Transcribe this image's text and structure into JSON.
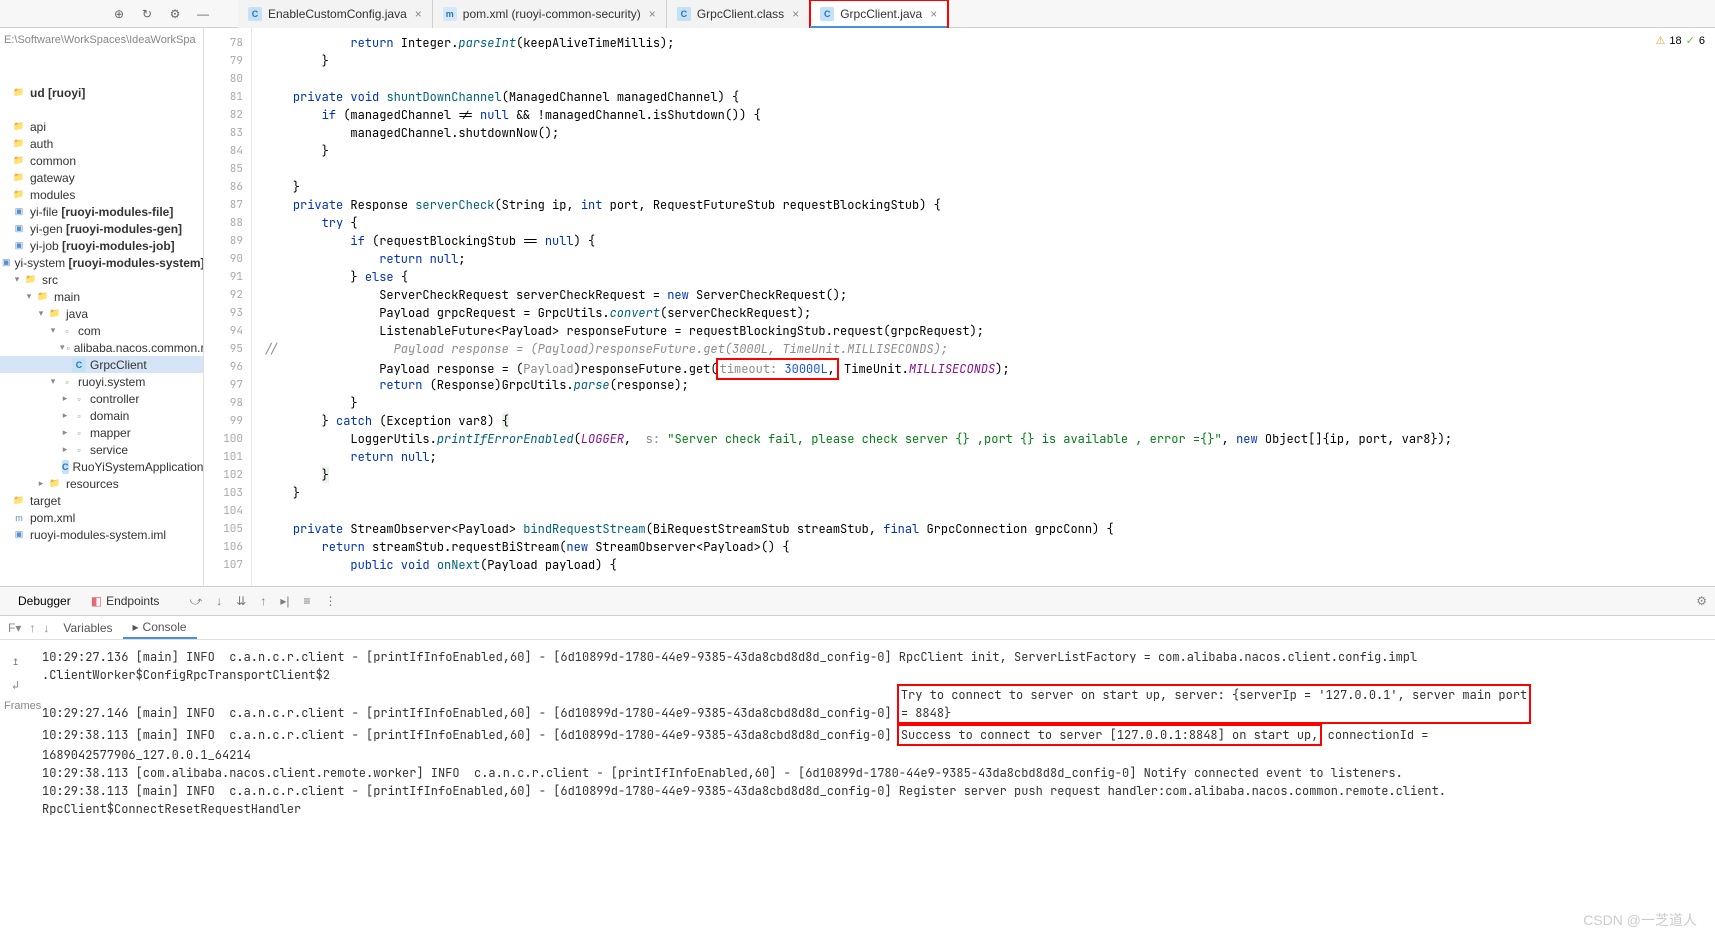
{
  "path_hint": "E:\\Software\\WorkSpaces\\IdeaWorkSpa",
  "warnings_count": "18",
  "ok_count": "6",
  "toolbar_tabs": [
    {
      "icon": "java",
      "label": "EnableCustomConfig.java",
      "active": false,
      "hl": false
    },
    {
      "icon": "xml",
      "label": "pom.xml (ruoyi-common-security)",
      "active": false,
      "hl": false
    },
    {
      "icon": "class",
      "label": "GrpcClient.class",
      "active": false,
      "hl": false
    },
    {
      "icon": "java",
      "label": "GrpcClient.java",
      "active": true,
      "hl": true
    }
  ],
  "tree": [
    {
      "d": 0,
      "t": "bold",
      "label": "ud [ruoyi]",
      "icon": "folder",
      "exp": ""
    },
    {
      "d": 0,
      "t": "",
      "label": "",
      "icon": "",
      "exp": ""
    },
    {
      "d": 0,
      "t": "",
      "label": "api",
      "icon": "folder",
      "exp": ""
    },
    {
      "d": 0,
      "t": "",
      "label": "auth",
      "icon": "folder",
      "exp": ""
    },
    {
      "d": 0,
      "t": "",
      "label": "common",
      "icon": "folder",
      "exp": ""
    },
    {
      "d": 0,
      "t": "",
      "label": "gateway",
      "icon": "folder",
      "exp": ""
    },
    {
      "d": 0,
      "t": "",
      "label": "modules",
      "icon": "folder",
      "exp": ""
    },
    {
      "d": 0,
      "t": "bracket",
      "label": "yi-file [ruoyi-modules-file]",
      "icon": "mod",
      "exp": ""
    },
    {
      "d": 0,
      "t": "bracket",
      "label": "yi-gen [ruoyi-modules-gen]",
      "icon": "mod",
      "exp": ""
    },
    {
      "d": 0,
      "t": "bracket",
      "label": "yi-job [ruoyi-modules-job]",
      "icon": "mod",
      "exp": ""
    },
    {
      "d": 0,
      "t": "bracket",
      "label": "yi-system [ruoyi-modules-system]",
      "icon": "mod",
      "exp": ""
    },
    {
      "d": 1,
      "t": "",
      "label": "src",
      "icon": "folder",
      "exp": "v"
    },
    {
      "d": 2,
      "t": "",
      "label": "main",
      "icon": "folder",
      "exp": "v"
    },
    {
      "d": 3,
      "t": "",
      "label": "java",
      "icon": "folder",
      "exp": "v"
    },
    {
      "d": 4,
      "t": "",
      "label": "com",
      "icon": "pkg",
      "exp": "v"
    },
    {
      "d": 5,
      "t": "",
      "label": "alibaba.nacos.common.remo",
      "icon": "pkg",
      "exp": "v"
    },
    {
      "d": 5,
      "t": "sel",
      "label": "GrpcClient",
      "icon": "cls",
      "exp": ""
    },
    {
      "d": 4,
      "t": "",
      "label": "ruoyi.system",
      "icon": "pkg",
      "exp": "v"
    },
    {
      "d": 5,
      "t": "",
      "label": "controller",
      "icon": "pkg",
      "exp": ">"
    },
    {
      "d": 5,
      "t": "",
      "label": "domain",
      "icon": "pkg",
      "exp": ">"
    },
    {
      "d": 5,
      "t": "",
      "label": "mapper",
      "icon": "pkg",
      "exp": ">"
    },
    {
      "d": 5,
      "t": "",
      "label": "service",
      "icon": "pkg",
      "exp": ">"
    },
    {
      "d": 5,
      "t": "",
      "label": "RuoYiSystemApplication",
      "icon": "cls",
      "exp": ""
    },
    {
      "d": 3,
      "t": "",
      "label": "resources",
      "icon": "folder",
      "exp": ">"
    },
    {
      "d": 0,
      "t": "",
      "label": "target",
      "icon": "folder",
      "exp": ""
    },
    {
      "d": 0,
      "t": "",
      "label": "pom.xml",
      "icon": "xml",
      "exp": ""
    },
    {
      "d": 0,
      "t": "",
      "label": "ruoyi-modules-system.iml",
      "icon": "mod",
      "exp": ""
    }
  ],
  "code_lines": [
    {
      "n": 78,
      "h": "            <span class='kw'>return</span> Integer.<span class='fni'>parseInt</span>(keepAliveTimeMillis);"
    },
    {
      "n": 79,
      "h": "        }"
    },
    {
      "n": 80,
      "h": ""
    },
    {
      "n": 81,
      "h": "    <span class='kw'>private</span> <span class='kw'>void</span> <span class='fn'>shuntDownChannel</span>(ManagedChannel managedChannel) {"
    },
    {
      "n": 82,
      "h": "        <span class='kw'>if</span> (managedChannel != <span class='kw'>null</span> && !managedChannel.isShutdown()) {"
    },
    {
      "n": 83,
      "h": "            managedChannel.shutdownNow();"
    },
    {
      "n": 84,
      "h": "        }"
    },
    {
      "n": 85,
      "h": ""
    },
    {
      "n": 86,
      "h": "    }"
    },
    {
      "n": 87,
      "h": "    <span class='kw'>private</span> Response <span class='fn'>serverCheck</span>(String ip, <span class='kw'>int</span> port, RequestFutureStub requestBlockingStub) {"
    },
    {
      "n": 88,
      "h": "        <span class='kw'>try</span> {"
    },
    {
      "n": 89,
      "h": "            <span class='kw'>if</span> (requestBlockingStub == <span class='kw'>null</span>) {"
    },
    {
      "n": 90,
      "h": "                <span class='kw'>return</span> <span class='kw'>null</span>;"
    },
    {
      "n": 91,
      "h": "            } <span class='kw'>else</span> {"
    },
    {
      "n": 92,
      "h": "                ServerCheckRequest serverCheckRequest = <span class='kw'>new</span> ServerCheckRequest();"
    },
    {
      "n": 93,
      "h": "                Payload grpcRequest = GrpcUtils.<span class='fni'>convert</span>(serverCheckRequest);"
    },
    {
      "n": 94,
      "h": "                ListenableFuture&lt;Payload&gt; responseFuture = requestBlockingStub.request(grpcRequest);"
    },
    {
      "n": 95,
      "h": "<span class='com'>//                Payload response = (Payload)responseFuture.get(3000L, TimeUnit.MILLISECONDS);</span>"
    },
    {
      "n": 96,
      "h": "                Payload response = (<span class='param'>Payload</span>)responseFuture.get(<span class='hlbox'><span class='param'>timeout:</span> <span class='num'>30000L</span>,</span> TimeUnit.<span class='const'>MILLISECONDS</span>);"
    },
    {
      "n": 97,
      "h": "                <span class='kw'>return</span> (Response)GrpcUtils.<span class='fni'>parse</span>(response);"
    },
    {
      "n": 98,
      "h": "            }"
    },
    {
      "n": 99,
      "h": "        } <span class='kw'>catch</span> (Exception var8) <span style='background:#e8f4e8'>{</span>"
    },
    {
      "n": 100,
      "h": "            LoggerUtils.<span class='fni'>printIfErrorEnabled</span>(<span class='const'>LOGGER</span>,  <span class='param'>s:</span> <span class='str'>\"Server check fail, please check server {} ,port {} is available , error ={}\"</span>, <span class='kw'>new</span> Object[]{ip, port, var8});"
    },
    {
      "n": 101,
      "h": "            <span class='kw'>return</span> <span class='kw'>null</span>;"
    },
    {
      "n": 102,
      "h": "        <span style='background:#e8f4e8'>}</span>"
    },
    {
      "n": 103,
      "h": "    }"
    },
    {
      "n": 104,
      "h": ""
    },
    {
      "n": 105,
      "h": "    <span class='kw'>private</span> StreamObserver&lt;Payload&gt; <span class='fn'>bindRequestStream</span>(BiRequestStreamStub streamStub, <span class='kw'>final</span> GrpcConnection grpcConn) {"
    },
    {
      "n": 106,
      "h": "        <span class='kw'>return</span> streamStub.requestBiStream(<span class='kw'>new</span> StreamObserver&lt;Payload&gt;() {"
    },
    {
      "n": 107,
      "h": "            <span class='kw'>public void</span> <span class='fn'>onNext</span>(Payload payload) {"
    }
  ],
  "debugger": {
    "tab_debugger": "Debugger",
    "tab_endpoints": "Endpoints",
    "subtabs": {
      "f": "F",
      "variables": "Variables",
      "console": "Console"
    },
    "frames": "Frames"
  },
  "console_lines": [
    {
      "pre": "10:29:27.136 [main] INFO  c.a.n.c.r.client - [printIfInfoEnabled,60] - [6d10899d-1780-44e9-9385-43da8cbd8d8d_config-0] RpcClient init, ServerListFactory = com.alibaba.nacos.client.config.impl\n.ClientWorker$ConfigRpcTransportClient$2",
      "hl": ""
    },
    {
      "pre": "10:29:27.146 [main] INFO  c.a.n.c.r.client - [printIfInfoEnabled,60] - [6d10899d-1780-44e9-9385-43da8cbd8d8d_config-0] ",
      "hl": "Try to connect to server on start up, server: {serverIp = '127.0.0.1', server main port\n= 8848}"
    },
    {
      "pre": "10:29:38.113 [main] INFO  c.a.n.c.r.client - [printIfInfoEnabled,60] - [6d10899d-1780-44e9-9385-43da8cbd8d8d_config-0] ",
      "hl": "Success to connect to server [127.0.0.1:8848] on start up,",
      "post": " connectionId = \n1689042577906_127.0.0.1_64214"
    },
    {
      "pre": "10:29:38.113 [com.alibaba.nacos.client.remote.worker] INFO  c.a.n.c.r.client - [printIfInfoEnabled,60] - [6d10899d-1780-44e9-9385-43da8cbd8d8d_config-0] Notify connected event to listeners.",
      "hl": ""
    },
    {
      "pre": "10:29:38.113 [main] INFO  c.a.n.c.r.client - [printIfInfoEnabled,60] - [6d10899d-1780-44e9-9385-43da8cbd8d8d_config-0] Register server push request handler:com.alibaba.nacos.common.remote.client.\nRpcClient$ConnectResetRequestHandler",
      "hl": ""
    }
  ],
  "watermark": "CSDN @一芝道人"
}
